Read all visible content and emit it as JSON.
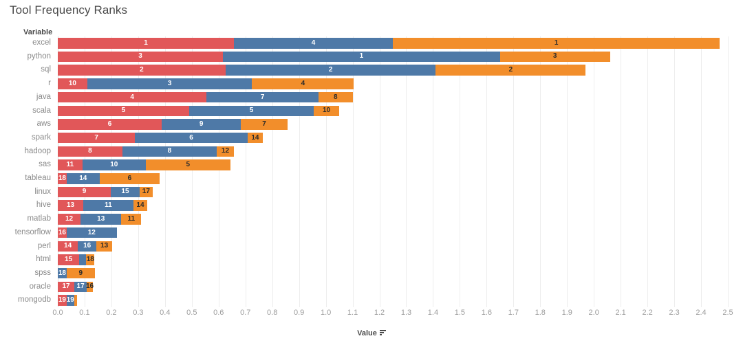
{
  "title": "Tool Frequency Ranks",
  "axis": {
    "variable_header": "Variable",
    "value_label": "Value",
    "sort_icon": "sort-descending-icon",
    "ticks": [
      "0.0",
      "0.1",
      "0.2",
      "0.3",
      "0.4",
      "0.5",
      "0.6",
      "0.7",
      "0.8",
      "0.9",
      "1.0",
      "1.1",
      "1.2",
      "1.3",
      "1.4",
      "1.5",
      "1.6",
      "1.7",
      "1.8",
      "1.9",
      "2.0",
      "2.1",
      "2.2",
      "2.3",
      "2.4",
      "2.5"
    ]
  },
  "colors": {
    "series1": "#e15759",
    "series2": "#4e79a7",
    "series3": "#f28e2b",
    "gridline": "#ededed",
    "axis_text": "#9b9b9b",
    "label_text": "#8a8a8a",
    "title_text": "#4a4a4a"
  },
  "chart_data": {
    "type": "bar",
    "title": "Tool Frequency Ranks",
    "xlabel": "Value",
    "ylabel": "Variable",
    "xlim": [
      0.0,
      2.5
    ],
    "grid": true,
    "stacked": true,
    "orientation": "horizontal",
    "legend": "none",
    "categories": [
      "excel",
      "python",
      "sql",
      "r",
      "java",
      "scala",
      "aws",
      "spark",
      "hadoop",
      "sas",
      "tableau",
      "linux",
      "hive",
      "matlab",
      "tensorflow",
      "perl",
      "html",
      "spss",
      "oracle",
      "mongodb"
    ],
    "series": [
      {
        "name": "series1",
        "color": "#e15759",
        "values": [
          0.657,
          0.616,
          0.626,
          0.11,
          0.555,
          0.49,
          0.388,
          0.288,
          0.241,
          0.092,
          0.033,
          0.198,
          0.095,
          0.085,
          0.033,
          0.075,
          0.08,
          0.0,
          0.062,
          0.033
        ]
      },
      {
        "name": "series2",
        "color": "#4e79a7",
        "values": [
          0.593,
          1.034,
          0.784,
          0.615,
          0.418,
          0.465,
          0.295,
          0.42,
          0.352,
          0.236,
          0.123,
          0.107,
          0.187,
          0.152,
          0.187,
          0.069,
          0.026,
          0.033,
          0.046,
          0.028
        ]
      },
      {
        "name": "series3",
        "color": "#f28e2b",
        "values": [
          1.22,
          0.41,
          0.56,
          0.38,
          0.127,
          0.095,
          0.174,
          0.057,
          0.064,
          0.316,
          0.224,
          0.049,
          0.052,
          0.074,
          0.0,
          0.059,
          0.031,
          0.105,
          0.023,
          0.01
        ]
      }
    ],
    "data_labels": [
      {
        "category": "excel",
        "labels": [
          "1",
          "4",
          "1"
        ]
      },
      {
        "category": "python",
        "labels": [
          "3",
          "1",
          "3"
        ]
      },
      {
        "category": "sql",
        "labels": [
          "2",
          "2",
          "2"
        ]
      },
      {
        "category": "r",
        "labels": [
          "10",
          "3",
          "4"
        ]
      },
      {
        "category": "java",
        "labels": [
          "4",
          "7",
          "8"
        ]
      },
      {
        "category": "scala",
        "labels": [
          "5",
          "5",
          "10"
        ]
      },
      {
        "category": "aws",
        "labels": [
          "6",
          "9",
          "7"
        ]
      },
      {
        "category": "spark",
        "labels": [
          "7",
          "6",
          "14"
        ]
      },
      {
        "category": "hadoop",
        "labels": [
          "8",
          "8",
          "12"
        ]
      },
      {
        "category": "sas",
        "labels": [
          "11",
          "10",
          "5"
        ]
      },
      {
        "category": "tableau",
        "labels": [
          "18",
          "14",
          "6"
        ]
      },
      {
        "category": "linux",
        "labels": [
          "9",
          "15",
          "17"
        ]
      },
      {
        "category": "hive",
        "labels": [
          "13",
          "11",
          "14"
        ]
      },
      {
        "category": "matlab",
        "labels": [
          "12",
          "13",
          "11"
        ]
      },
      {
        "category": "tensorflow",
        "labels": [
          "16",
          "12",
          ""
        ]
      },
      {
        "category": "perl",
        "labels": [
          "14",
          "16",
          "13"
        ]
      },
      {
        "category": "html",
        "labels": [
          "15",
          "",
          "18"
        ]
      },
      {
        "category": "spss",
        "labels": [
          "",
          "18",
          "9"
        ]
      },
      {
        "category": "oracle",
        "labels": [
          "17",
          "17",
          "16"
        ]
      },
      {
        "category": "mongodb",
        "labels": [
          "19",
          "19",
          ""
        ]
      }
    ]
  }
}
